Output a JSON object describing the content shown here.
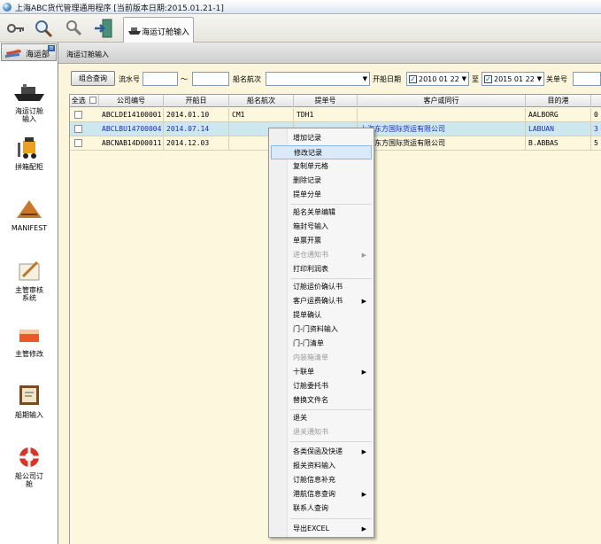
{
  "window": {
    "title": "上海ABC货代管理通用程序   [当前版本日期:2015.01.21-1]"
  },
  "toolbar": {
    "buttons": [
      "key-icon",
      "search-icon",
      "find-icon",
      "exit-icon"
    ],
    "active_tab": "海运订舱输入"
  },
  "sidebar": {
    "dept": "海运部",
    "pin": "≡",
    "items": [
      {
        "icon": "ship-icon",
        "label": "海运订舱\n输入"
      },
      {
        "icon": "forklift-icon",
        "label": "拼箱配柜"
      },
      {
        "icon": "manifest-icon",
        "label": "MANIFEST"
      },
      {
        "icon": "approve-icon",
        "label": "主管审核\n系统"
      },
      {
        "icon": "edit-box-icon",
        "label": "主管修改"
      },
      {
        "icon": "schedule-icon",
        "label": "船期输入"
      },
      {
        "icon": "lifebuoy-icon",
        "label": "船公司订\n舱"
      }
    ]
  },
  "panel": {
    "title": "海运订舱输入"
  },
  "search": {
    "combo_button": "组合查询",
    "serial_label": "流水号",
    "tilde": "～",
    "vessel_label": "船名航次",
    "date_label": "开船日期",
    "date_from": "2010  01  22",
    "to_label": "至",
    "date_to": "2015  01  22",
    "bl_label": "关单号",
    "check_mark": "✓",
    "drop_glyph": "▼"
  },
  "grid": {
    "select_all": "全选",
    "columns": [
      "公司编号",
      "开船日",
      "船名航次",
      "提单号",
      "客户或同行",
      "目的港"
    ],
    "rows": [
      {
        "id": "ABCLDE14100001",
        "date": "2014.01.10",
        "vessel": "CM1",
        "bl": "TDH1",
        "client": "",
        "port": "AALBORG",
        "extra": "0",
        "selected": false
      },
      {
        "id": "ABCLBU14700004",
        "date": "2014.07.14",
        "vessel": "",
        "bl": "",
        "client": "上海东方国际货运有限公司",
        "port": "LABUAN",
        "extra": "3",
        "selected": true
      },
      {
        "id": "ABCNAB14D00011",
        "date": "2014.12.03",
        "vessel": "",
        "bl": "",
        "client": "上海东方国际货运有限公司",
        "port": "B.ABBAS",
        "extra": "5",
        "selected": false
      }
    ]
  },
  "context_menu": {
    "submenu_arrow": "▶",
    "items": [
      {
        "label": "增加记录",
        "state": "normal",
        "sub": false
      },
      {
        "label": "修改记录",
        "state": "highlight",
        "sub": false
      },
      {
        "label": "复制单元格",
        "state": "normal",
        "sub": false
      },
      {
        "label": "删除记录",
        "state": "normal",
        "sub": false
      },
      {
        "label": "提单分单",
        "state": "normal",
        "sub": false
      },
      {
        "label": "船名关单编辑",
        "state": "normal",
        "sub": false
      },
      {
        "label": "箱封号输入",
        "state": "normal",
        "sub": false
      },
      {
        "label": "单票开票",
        "state": "normal",
        "sub": false
      },
      {
        "label": "进仓通知书",
        "state": "disabled",
        "sub": true
      },
      {
        "label": "打印利润表",
        "state": "normal",
        "sub": false
      },
      {
        "label": "订舱运价确认书",
        "state": "normal",
        "sub": false
      },
      {
        "label": "客户运费确认书",
        "state": "normal",
        "sub": true
      },
      {
        "label": "提单确认",
        "state": "normal",
        "sub": false
      },
      {
        "label": "门-门资料输入",
        "state": "normal",
        "sub": false
      },
      {
        "label": "门-门清单",
        "state": "normal",
        "sub": false
      },
      {
        "label": "内装箱清单",
        "state": "disabled",
        "sub": false
      },
      {
        "label": "十联单",
        "state": "normal",
        "sub": true
      },
      {
        "label": "订舱委托书",
        "state": "normal",
        "sub": false
      },
      {
        "label": "替换文件名",
        "state": "normal",
        "sub": false
      },
      {
        "label": "退关",
        "state": "normal",
        "sub": false
      },
      {
        "label": "退关通知书",
        "state": "disabled",
        "sub": false
      },
      {
        "label": "各类保函及快递",
        "state": "normal",
        "sub": true
      },
      {
        "label": "报关资料输入",
        "state": "normal",
        "sub": false
      },
      {
        "label": "订舱信息补充",
        "state": "normal",
        "sub": false
      },
      {
        "label": "港航信息查询",
        "state": "normal",
        "sub": true
      },
      {
        "label": "联系人查询",
        "state": "normal",
        "sub": false
      },
      {
        "label": "导出EXCEL",
        "state": "normal",
        "sub": true
      }
    ]
  }
}
